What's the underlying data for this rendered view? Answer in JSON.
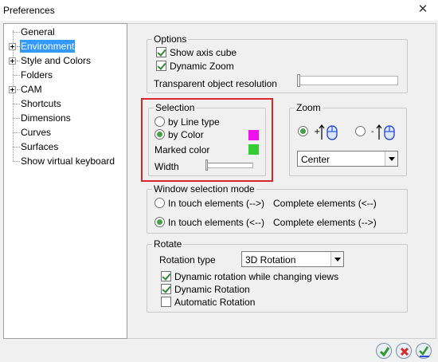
{
  "window": {
    "title": "Preferences"
  },
  "tree": {
    "items": [
      {
        "label": "General"
      },
      {
        "label": "Environment"
      },
      {
        "label": "Style and Colors"
      },
      {
        "label": "Folders"
      },
      {
        "label": "CAM"
      },
      {
        "label": "Shortcuts"
      },
      {
        "label": "Dimensions"
      },
      {
        "label": "Curves"
      },
      {
        "label": "Surfaces"
      },
      {
        "label": "Show virtual keyboard"
      }
    ],
    "selected": "Environment"
  },
  "options": {
    "legend": "Options",
    "show_axis_cube": "Show axis cube",
    "dynamic_zoom": "Dynamic Zoom",
    "transparent_resolution": "Transparent object resolution"
  },
  "selection": {
    "legend": "Selection",
    "by_line_type": "by Line type",
    "by_color": "by Color",
    "marked_color": "Marked color",
    "width": "Width",
    "by_color_swatch": "#ee11ee",
    "marked_color_swatch": "#33cc33"
  },
  "zoom": {
    "legend": "Zoom",
    "center": "Center"
  },
  "window_selection": {
    "legend": "Window selection mode",
    "opt1_left": "In touch elements (-->)",
    "opt1_right": "Complete elements (<--)",
    "opt2_left": "In touch elements (<--)",
    "opt2_right": "Complete elements (-->)"
  },
  "rotate": {
    "legend": "Rotate",
    "rotation_type_label": "Rotation type",
    "rotation_type_value": "3D Rotation",
    "dynamic_while_changing": "Dynamic rotation while changing views",
    "dynamic_rotation": "Dynamic Rotation",
    "automatic_rotation": "Automatic Rotation"
  },
  "colors": {
    "selection_highlight": "#3399ff",
    "annotation_red": "#d9262c"
  }
}
